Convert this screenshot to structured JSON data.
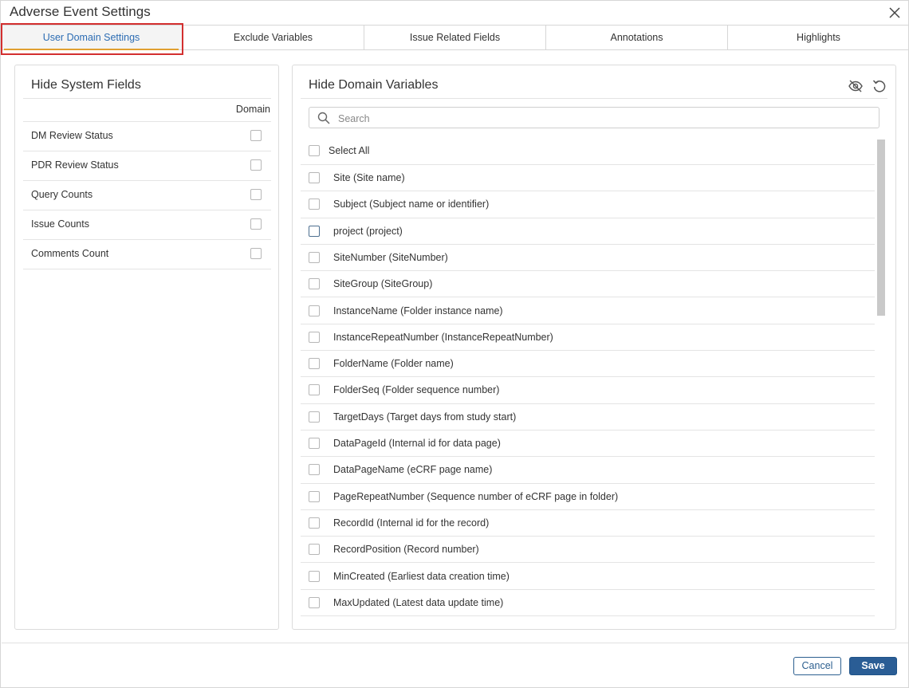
{
  "dialog": {
    "title": "Adverse Event Settings"
  },
  "tabs": [
    {
      "label": "User Domain Settings",
      "active": true
    },
    {
      "label": "Exclude Variables"
    },
    {
      "label": "Issue Related Fields"
    },
    {
      "label": "Annotations"
    },
    {
      "label": "Highlights"
    }
  ],
  "left_panel": {
    "title": "Hide System Fields",
    "column_header": "Domain",
    "rows": [
      {
        "label": "DM Review Status"
      },
      {
        "label": "PDR Review Status"
      },
      {
        "label": "Query Counts"
      },
      {
        "label": "Issue Counts"
      },
      {
        "label": "Comments Count"
      }
    ]
  },
  "right_panel": {
    "title": "Hide Domain Variables",
    "search_placeholder": "Search",
    "select_all": "Select All",
    "variables": [
      {
        "label": "Site (Site name)"
      },
      {
        "label": "Subject (Subject name or identifier)"
      },
      {
        "label": "project (project)"
      },
      {
        "label": "SiteNumber (SiteNumber)"
      },
      {
        "label": "SiteGroup (SiteGroup)"
      },
      {
        "label": "InstanceName (Folder instance name)"
      },
      {
        "label": "InstanceRepeatNumber (InstanceRepeatNumber)"
      },
      {
        "label": "FolderName (Folder name)"
      },
      {
        "label": "FolderSeq (Folder sequence number)"
      },
      {
        "label": "TargetDays (Target days from study start)"
      },
      {
        "label": "DataPageId (Internal id for data page)"
      },
      {
        "label": "DataPageName (eCRF page name)"
      },
      {
        "label": "PageRepeatNumber (Sequence number of eCRF page in folder)"
      },
      {
        "label": "RecordId (Internal id for the record)"
      },
      {
        "label": "RecordPosition (Record number)"
      },
      {
        "label": "MinCreated (Earliest data creation time)"
      },
      {
        "label": "MaxUpdated (Latest data update time)"
      }
    ]
  },
  "footer": {
    "cancel_label": "Cancel",
    "save_label": "Save"
  },
  "colors": {
    "accent": "#2a5d95",
    "active_tab_text": "#2c6cb3",
    "highlight_box": "#d32f2f"
  }
}
